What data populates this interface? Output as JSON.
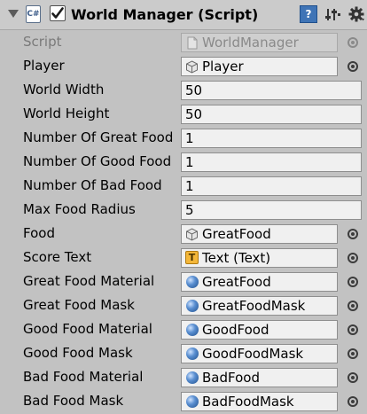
{
  "header": {
    "title": "World Manager (Script)",
    "enabled": true,
    "script_icon_text": "C#",
    "help_icon_text": "?"
  },
  "fields": [
    {
      "label": "Script",
      "type": "object",
      "value": "WorldManager",
      "icon": "script-file-icon",
      "disabled": true
    },
    {
      "label": "Player",
      "type": "object",
      "value": "Player",
      "icon": "cube-icon"
    },
    {
      "label": "World Width",
      "type": "number",
      "value": "50"
    },
    {
      "label": "World Height",
      "type": "number",
      "value": "50"
    },
    {
      "label": "Number Of Great Food",
      "type": "number",
      "value": "1"
    },
    {
      "label": "Number Of Good Food",
      "type": "number",
      "value": "1"
    },
    {
      "label": "Number Of Bad Food",
      "type": "number",
      "value": "1"
    },
    {
      "label": "Max Food Radius",
      "type": "number",
      "value": "5"
    },
    {
      "label": "Food",
      "type": "object",
      "value": "GreatFood",
      "icon": "cube-icon"
    },
    {
      "label": "Score Text",
      "type": "object",
      "value": "Text (Text)",
      "icon": "text-icon",
      "icon_text": "T"
    },
    {
      "label": "Great Food Material",
      "type": "object",
      "value": "GreatFood",
      "icon": "material-sphere-icon"
    },
    {
      "label": "Great Food Mask",
      "type": "object",
      "value": "GreatFoodMask",
      "icon": "material-sphere-icon"
    },
    {
      "label": "Good Food Material",
      "type": "object",
      "value": "GoodFood",
      "icon": "material-sphere-icon"
    },
    {
      "label": "Good Food Mask",
      "type": "object",
      "value": "GoodFoodMask",
      "icon": "material-sphere-icon"
    },
    {
      "label": "Bad Food Material",
      "type": "object",
      "value": "BadFood",
      "icon": "material-sphere-icon"
    },
    {
      "label": "Bad Food Mask",
      "type": "object",
      "value": "BadFoodMask",
      "icon": "material-sphere-icon"
    }
  ]
}
